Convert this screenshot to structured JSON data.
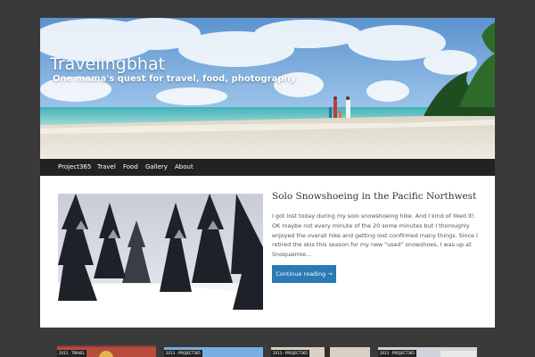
{
  "site": {
    "title": "Travelingbhat",
    "tagline": "One mama's quest for travel, food, photography"
  },
  "nav": {
    "items": [
      {
        "label": "Project365"
      },
      {
        "label": "Travel"
      },
      {
        "label": "Food"
      },
      {
        "label": "Gallery"
      },
      {
        "label": "About"
      }
    ]
  },
  "featured_post": {
    "title": "Solo Snowshoeing in the Pacific Northwest",
    "excerpt": "I got lost today during my solo snowshoeing hike. And I kind of liked it!. OK maybe not every minute of the 20 some minutes but I thoroughly enjoyed the overall hike and getting lost confirmed many things. Since I retired the skis this season for my new \"used\" snowshoes, I was up at Snoqualmie…",
    "read_more": "Continue reading →"
  },
  "recent_posts": [
    {
      "tag": "2013 · TRAVEL"
    },
    {
      "tag": "2013 · PROJECT365"
    },
    {
      "tag": "2013 · PROJECT365"
    },
    {
      "tag": "2013 · PROJECT365"
    }
  ],
  "colors": {
    "page_bg": "#3a3a3a",
    "nav_bg": "#222222",
    "button_bg": "#2a7ab6",
    "content_bg": "#ffffff"
  }
}
